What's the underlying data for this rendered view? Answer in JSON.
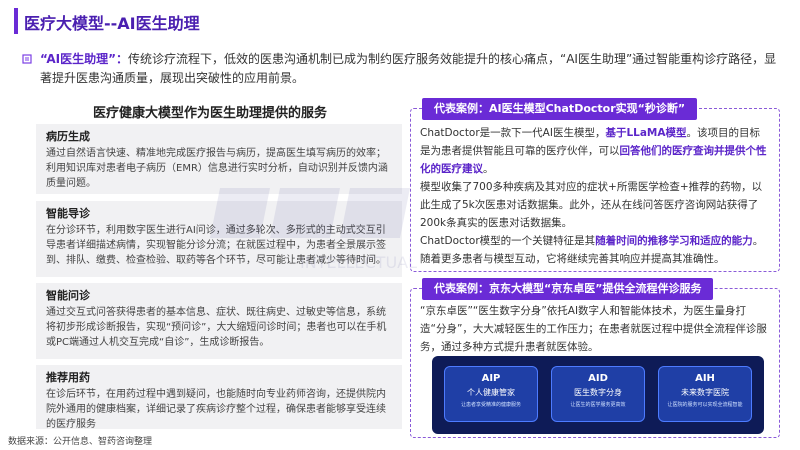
{
  "page": {
    "title": "医疗大模型--AI医生助理"
  },
  "intro": {
    "highlight": "“AI医生助理”：",
    "text": "传统诊疗流程下，低效的医患沟通机制已成为制约医疗服务效能提升的核心痛点，“AI医生助理”通过智能重构诊疗路径，显著提升医患沟通质量，展现出突破性的应用前景。"
  },
  "left": {
    "title": "医疗健康大模型作为医生助理提供的服务",
    "cards": [
      {
        "title": "病历生成",
        "body": "通过自然语言快速、精准地完成医疗报告与病历，提高医生填写病历的效率；利用知识库对患者电子病历（EMR）信息进行实时分析，自动识别并反馈内涵质量问题。"
      },
      {
        "title": "智能导诊",
        "body": "在分诊环节，利用数字医生进行AI问诊，通过多轮次、多形式的主动式交互引导患者详细描述病情，实现智能分诊分流；在就医过程中，为患者全景展示签到、排队、缴费、检查检验、取药等各个环节，尽可能让患者减少等待时间。"
      },
      {
        "title": "智能问诊",
        "body": "通过交互式问答获得患者的基本信息、症状、既往病史、过敏史等信息，系统将初步形成诊断报告，实现“预问诊”，大大缩短问诊时间；患者也可以在手机或PC端通过人机交互完成“自诊”，生成诊断报告。"
      },
      {
        "title": "推荐用药",
        "body": "在诊后环节，在用药过程中遇到疑问，也能随时向专业药师咨询，还提供院内院外通用的健康档案，详细记录了疾病诊疗整个过程，确保患者能够享受连续的医疗服务"
      }
    ]
  },
  "watermark": {
    "text": "INTELLECTUAL"
  },
  "case1": {
    "header": "代表案例：AI医生模型ChatDoctor实现“秒诊断”",
    "p1_a": "ChatDoctor是一款下一代AI医生模型，",
    "p1_b": "基于LLaMA模型",
    "p1_c": "。该项目的目标是为患者提供智能且可靠的医疗伙伴，可以",
    "p1_d": "回答他们的医疗查询并提供个性化的医疗建议",
    "p1_e": "。",
    "p2": "模型收集了700多种疾病及其对应的症状+所需医学检查+推荐的药物，以此生成了5k次医患对话数据集。此外，还从在线问答医疗咨询网站获得了200k条真实的医患对话数据集。",
    "p3_a": "ChatDoctor模型的一个关键特征是其",
    "p3_b": "随着时间的推移学习和适应的能力",
    "p3_c": "。随着更多患者与模型互动，它将继续完善其响应并提高其准确性。"
  },
  "case2": {
    "header": "代表案例：京东大模型“京东卓医”提供全流程伴诊服务",
    "text": "“京东卓医”“医生数字分身”依托AI数字人和智能体技术，为医生量身打造“分身”，大大减轻医生的工作压力；在患者就医过程中提供全流程伴诊服务，通过多种方式提升患者就医体验。",
    "tiles": [
      {
        "code": "AIP",
        "name": "个人健康管家",
        "desc": "让患者享受精准的健康服务"
      },
      {
        "code": "AID",
        "name": "医生数字分身",
        "desc": "让医生的医学服务更高效"
      },
      {
        "code": "AIH",
        "name": "未来数字医院",
        "desc": "让医院的服务可以实现全流程智能"
      }
    ]
  },
  "footer": {
    "source": "数据来源：公开信息、智药咨询整理"
  },
  "colors": {
    "accent": "#6a2bd6",
    "accent_text": "#5b25c9",
    "card_bg": "#f1f1f3",
    "panel_bg": "#0e1b57"
  }
}
